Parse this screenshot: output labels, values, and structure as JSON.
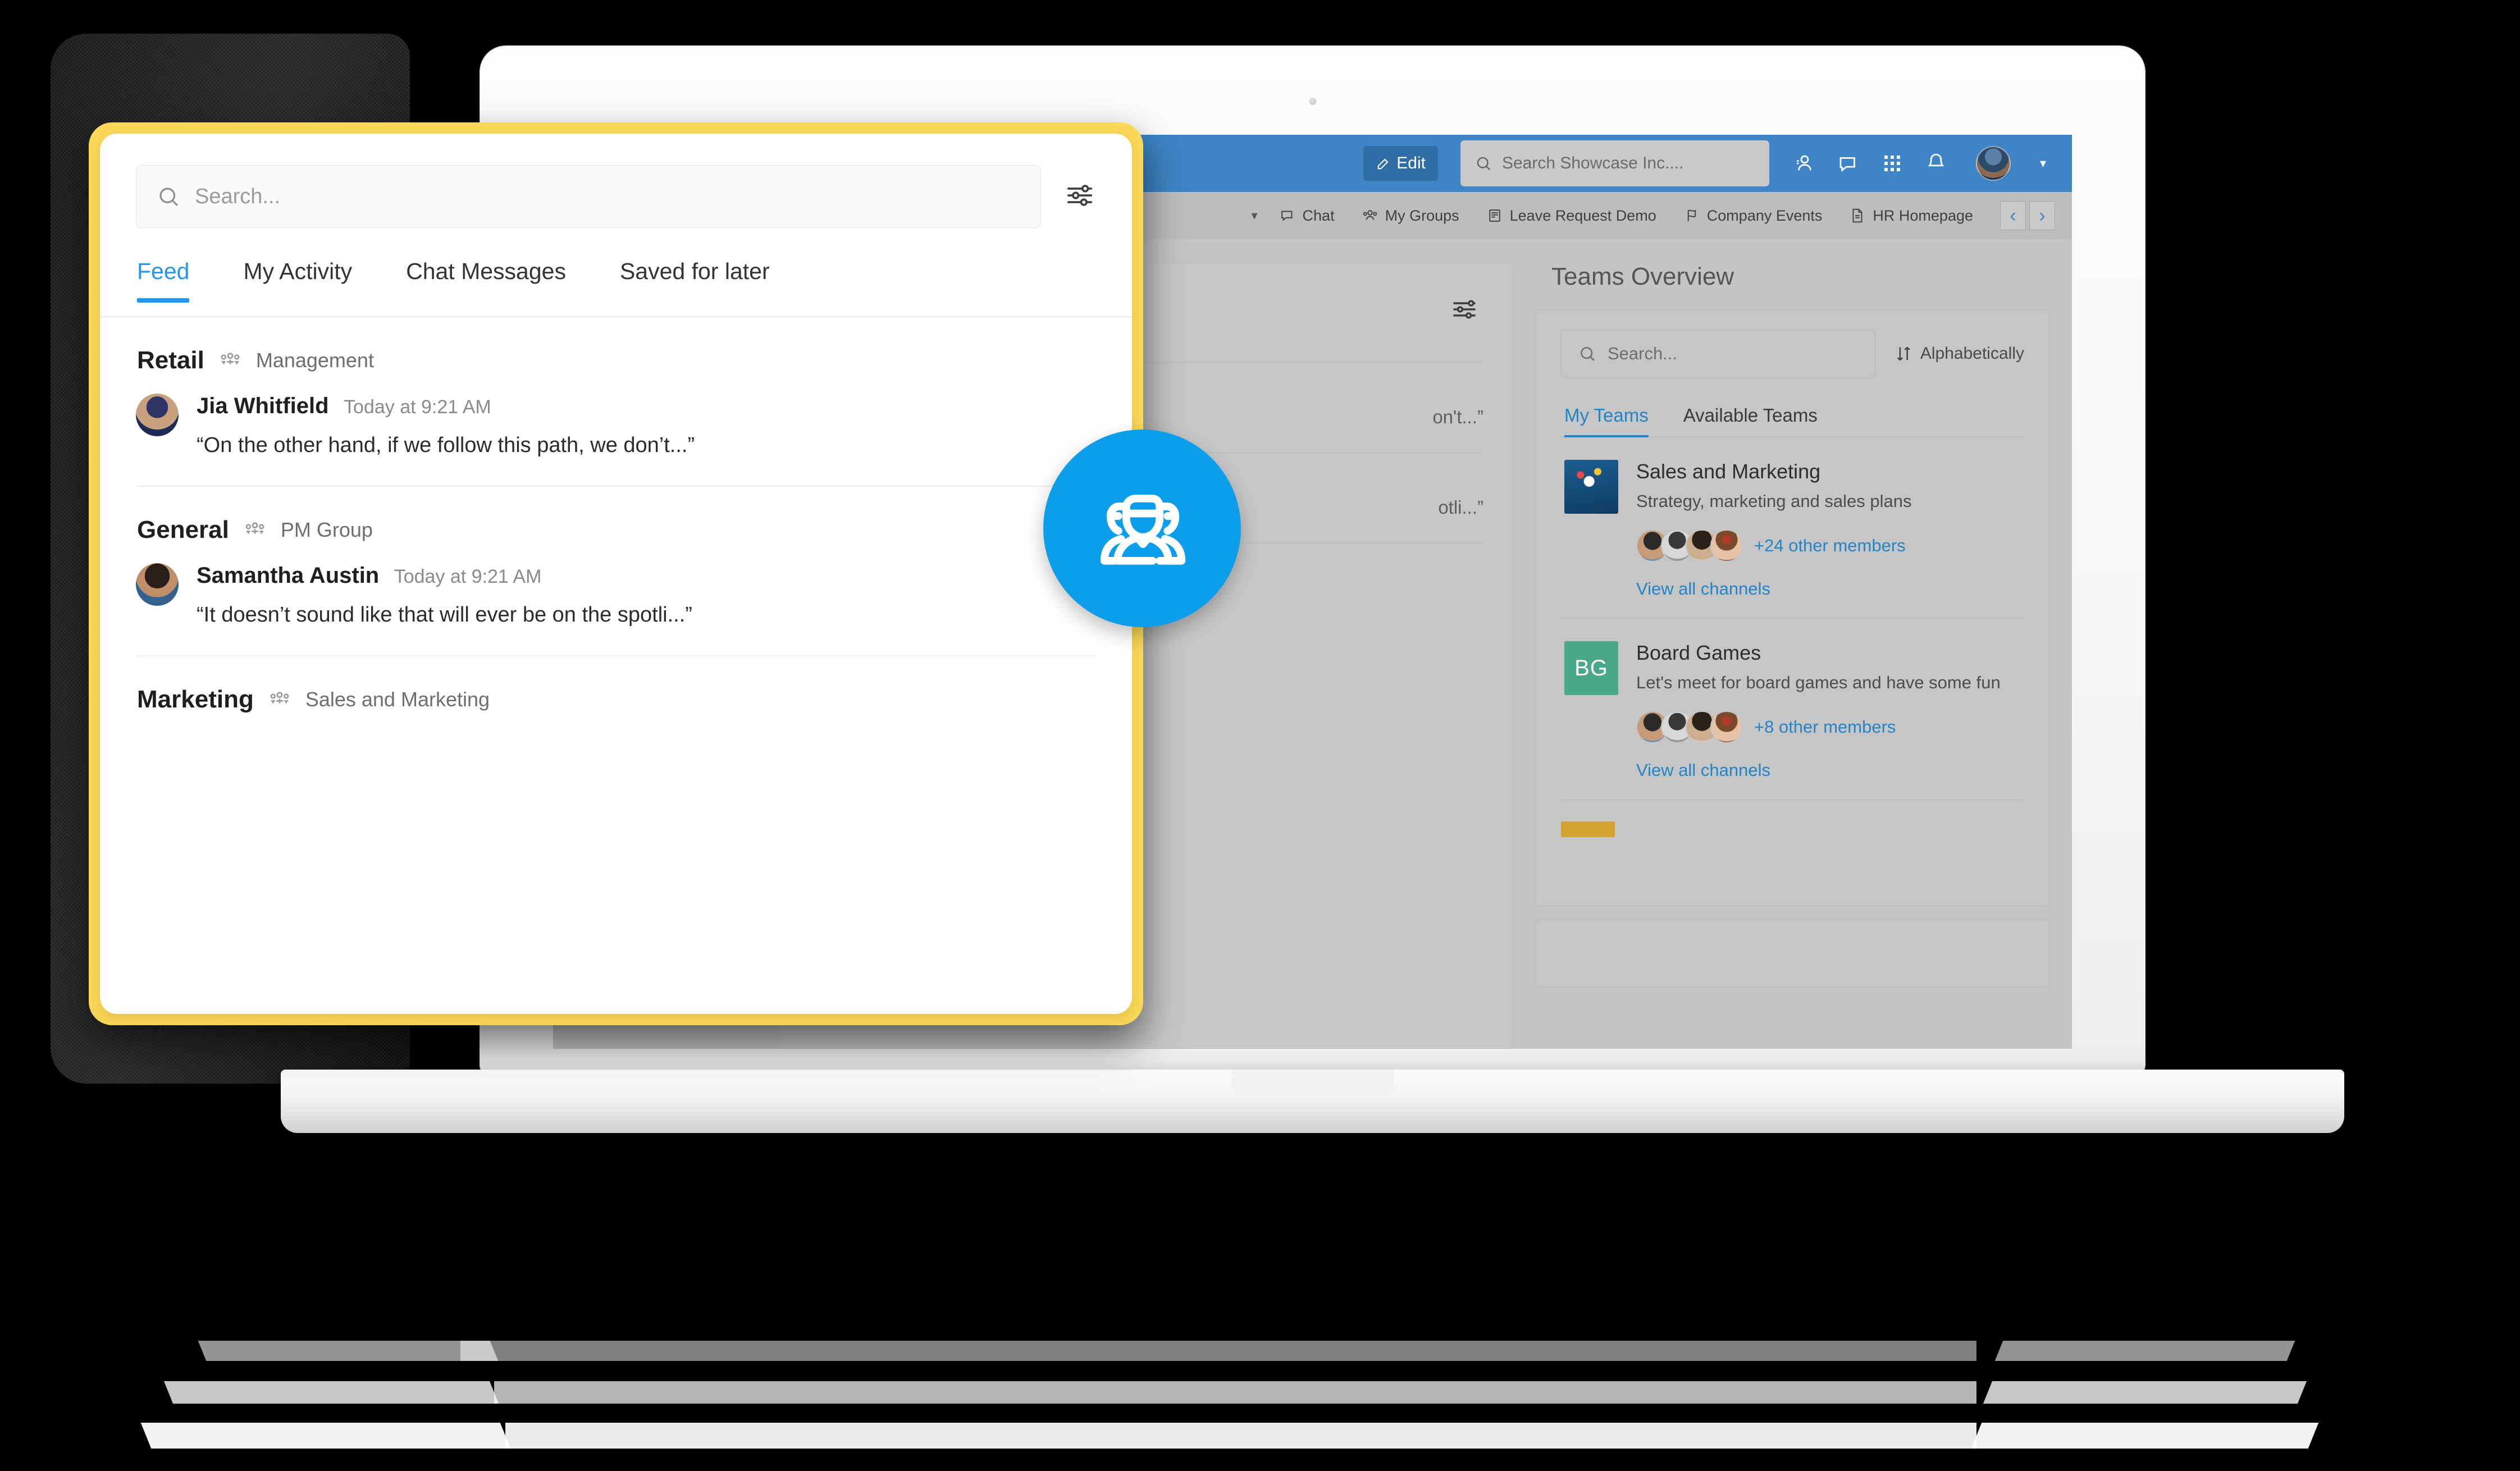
{
  "topbar": {
    "edit_label": "Edit",
    "search_placeholder": "Search Showcase Inc....",
    "icons": [
      "people-icon",
      "chat-bubble-icon",
      "apps-grid-icon",
      "bell-icon"
    ],
    "avatar": "user-avatar",
    "caret": "▾"
  },
  "navbar": {
    "caret": "▾",
    "items": [
      {
        "label": "Chat",
        "icon": "chat-bubble-icon"
      },
      {
        "label": "My Groups",
        "icon": "people-group-icon"
      },
      {
        "label": "Leave Request Demo",
        "icon": "document-stack-icon"
      },
      {
        "label": "Company Events",
        "icon": "flag-icon"
      },
      {
        "label": "HR Homepage",
        "icon": "page-icon"
      }
    ],
    "prev": "‹",
    "next": "›"
  },
  "ghost_card": {
    "text_1": "on't...”",
    "text_2": "otli...”",
    "slider_icon": "sliders-icon"
  },
  "teams": {
    "title": "Teams Overview",
    "search_placeholder": "Search...",
    "sort_label": "Alphabetically",
    "sort_icon": "sort-arrows-icon",
    "tabs": [
      {
        "label": "My Teams",
        "active": true
      },
      {
        "label": "Available Teams",
        "active": false
      }
    ],
    "view_all_label": "View all channels",
    "list": [
      {
        "name": "Sales and Marketing",
        "description": "Strategy, marketing and sales plans",
        "logo_type": "image",
        "logo_initials": "",
        "members_more": "+24 other members"
      },
      {
        "name": "Board Games",
        "description": "Let's meet for board games and have some fun",
        "logo_type": "initials",
        "logo_initials": "BG",
        "members_more": "+8 other members"
      }
    ]
  },
  "popup": {
    "search_placeholder": "Search...",
    "filter_icon": "sliders-icon",
    "tabs": [
      {
        "label": "Feed",
        "active": true
      },
      {
        "label": "My Activity",
        "active": false
      },
      {
        "label": "Chat Messages",
        "active": false
      },
      {
        "label": "Saved for later",
        "active": false
      }
    ],
    "groups": [
      {
        "name": "Retail",
        "group_icon": "people-group-icon",
        "subtitle": "Management",
        "message": {
          "author": "Jia Whitfield",
          "time": "Today at 9:21 AM",
          "text": "“On the other hand, if we follow this path, we don’t...”"
        }
      },
      {
        "name": "General",
        "group_icon": "people-group-icon",
        "subtitle": "PM Group",
        "message": {
          "author": "Samantha Austin",
          "time": "Today at 9:21 AM",
          "text": "“It doesn’t sound like that will ever be on the spotli...”"
        }
      },
      {
        "name": "Marketing",
        "group_icon": "people-group-icon",
        "subtitle": "Sales and Marketing",
        "message": null
      }
    ]
  },
  "badge": {
    "icon": "team-people-icon"
  },
  "colors": {
    "accent_blue": "#2196f3",
    "link_blue": "#2384c8",
    "topbar_blue": "#3d85c6",
    "badge_blue": "#0d9eeb",
    "highlight_yellow": "#fbd857",
    "team_green": "#4aa88a"
  }
}
